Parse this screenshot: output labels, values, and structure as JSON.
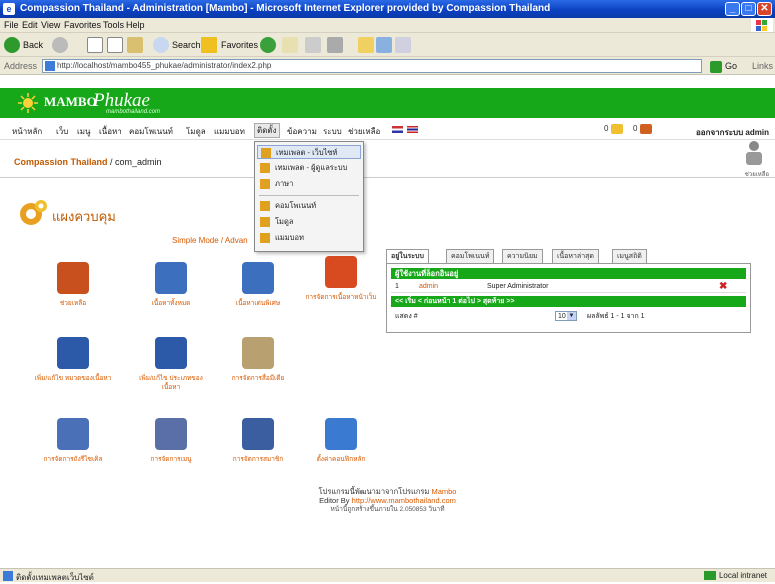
{
  "window": {
    "title": "Compassion Thailand - Administration [Mambo] - Microsoft Internet Explorer provided by Compassion Thailand"
  },
  "menubar": [
    "File",
    "Edit",
    "View",
    "Favorites",
    "Tools",
    "Help"
  ],
  "toolbar": {
    "back": "Back",
    "search": "Search",
    "favorites": "Favorites"
  },
  "address": {
    "label": "Address",
    "url": "http://localhost/mambo455_phukae/administrator/index2.php",
    "go": "Go",
    "links": "Links"
  },
  "header": {
    "brand": "MAMBO",
    "brand_italic": "Phukae",
    "subtitle": "mambothailand.com"
  },
  "site_menu": {
    "items": [
      "หน้าหลัก",
      "เว็บ",
      "เมนู",
      "เนื้อหา",
      "คอมโพเนนท์",
      "โมดูล",
      "แมมบอท",
      "ติดตั้ง",
      "ข้อความ",
      "ระบบ",
      "ช่วยเหลือ"
    ],
    "active_index": 7,
    "stat1": "0",
    "stat2": "0",
    "logout": "ออกจากระบบ admin"
  },
  "pathway": {
    "site": "Compassion Thailand",
    "rest": " / com_admin",
    "help_label": "ช่วยเหลือ"
  },
  "cpanel": {
    "title": "แผงควบคุม",
    "mode_links": "Simple Mode / Advan"
  },
  "dropdown": {
    "items": [
      {
        "label": "เทมเพลต - เว็บไซท์",
        "highlighted": true
      },
      {
        "label": "เทมเพลต - ผู้ดูแลระบบ",
        "highlighted": false
      },
      {
        "label": "ภาษา",
        "highlighted": false
      },
      {
        "label": "คอมโพเนนท์",
        "highlighted": false
      },
      {
        "label": "โมดูล",
        "highlighted": false
      },
      {
        "label": "แมมบอท",
        "highlighted": false
      }
    ]
  },
  "icons": [
    {
      "label": "ช่วยเหลือ",
      "icon": "help-icon",
      "color": "#c8501e"
    },
    {
      "label": "เนื้อหาทั้งหมด",
      "icon": "all-content-icon",
      "color": "#3d6fbf"
    },
    {
      "label": "เนื้อหาเด่นพิเศษ",
      "icon": "frontpage-icon",
      "color": "#3d6fbf"
    },
    {
      "label": "การจัดการเนื้อหาหน้าเว็บ",
      "icon": "static-content-icon",
      "color": "#d84a20"
    },
    {
      "label": "เพิ่ม/แก้ไข หมวดของเนื้อหา",
      "icon": "section-icon",
      "color": "#2c5aa8"
    },
    {
      "label": "เพิ่ม/แก้ไข ประเภทของเนื้อหา",
      "icon": "category-icon",
      "color": "#2c5aa8"
    },
    {
      "label": "การจัดการสื่อมีเดีย",
      "icon": "media-icon",
      "color": "#b8a070"
    },
    {
      "label": "การจัดการถังรีไซเคิล",
      "icon": "trash-icon",
      "color": "#4a70b8"
    },
    {
      "label": "การจัดการเมนู",
      "icon": "menu-icon",
      "color": "#5a6fa8"
    },
    {
      "label": "การจัดการสมาชิก",
      "icon": "users-icon",
      "color": "#3a5ea0"
    },
    {
      "label": "ตั้งค่าคอนฟิกหลัก",
      "icon": "config-icon",
      "color": "#3a7ad0"
    }
  ],
  "tabs": {
    "items": [
      "อยู่ในระบบ",
      "คอมโพเนนท์",
      "ความนิยม",
      "เนื้อหาล่าสุด",
      "เมนูสถิติ"
    ],
    "active_index": 0,
    "header": "ผู้ใช้งานที่ล็อกอินอยู่",
    "row": {
      "num": "1",
      "user": "admin",
      "group": "Super Administrator"
    },
    "nav": "<< เริ่ม < ก่อนหน้า 1 ต่อไป > สุดท้าย >>",
    "show_label": "แสดง #",
    "page_size": "10",
    "result": "ผลลัพธ์ 1 - 1 จาก 1"
  },
  "footer": {
    "line1": "โปรแกรมนี้พัฒนามาจากโปรแกรม",
    "line1_link": "Mambo",
    "line2": "Editor By",
    "line2_link": "http://www.mambothailand.com",
    "line3": "หน้านี้ถูกสร้างขึ้นภายใน 2.050853 วินาที"
  },
  "status": {
    "text": "ติดตั้งเทมเพลตเว็บไซต์",
    "zone": "Local intranet"
  },
  "colors": {
    "green": "#17a819",
    "orange": "#d85a00"
  }
}
